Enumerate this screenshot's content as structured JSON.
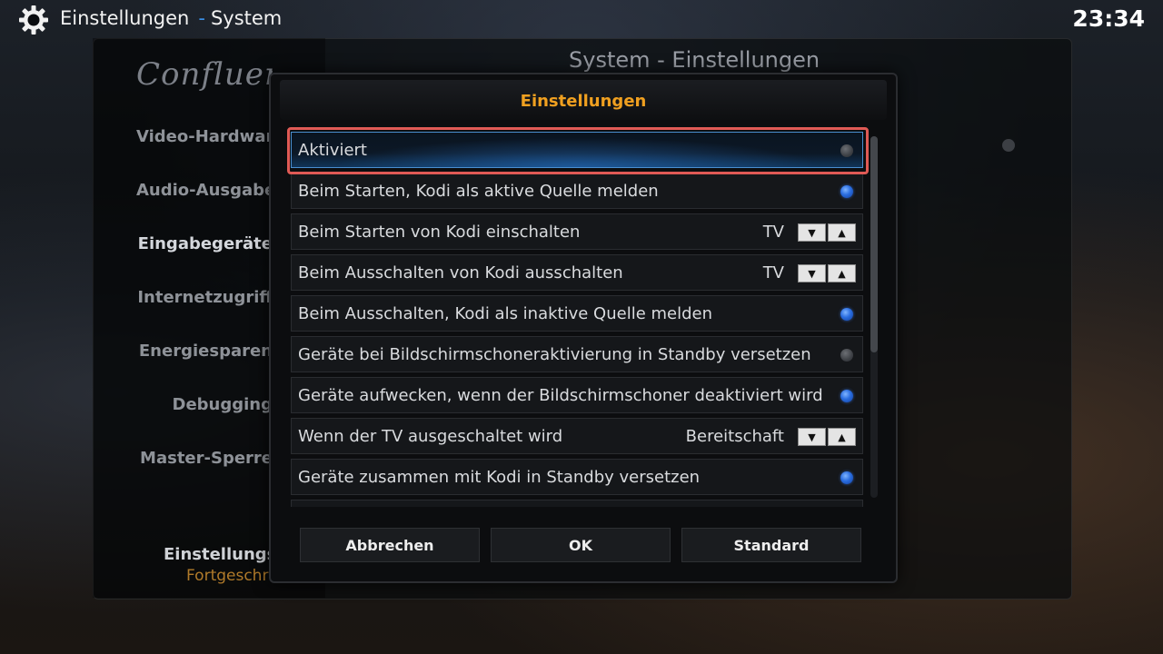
{
  "app": {
    "section": "Einstellungen",
    "subsection": "System",
    "clock": "23:34"
  },
  "background": {
    "logo": "Confluence",
    "panel_title": "System - Einstellungen",
    "categories": [
      {
        "label": "Video-Hardware"
      },
      {
        "label": "Audio-Ausgabe"
      },
      {
        "label": "Eingabegeräte"
      },
      {
        "label": "Internetzugriff"
      },
      {
        "label": "Energiesparen"
      },
      {
        "label": "Debugging"
      },
      {
        "label": "Master-Sperre"
      }
    ],
    "settings_level_label": "Einstellungsebene",
    "settings_level_value": "Fortgeschritten"
  },
  "dialog": {
    "title": "Einstellungen",
    "rows": [
      {
        "label": "Aktiviert",
        "type": "toggle",
        "on": false,
        "focused": true
      },
      {
        "label": "Beim Starten, Kodi als aktive Quelle melden",
        "type": "toggle",
        "on": true
      },
      {
        "label": "Beim Starten von Kodi einschalten",
        "type": "spinner",
        "value": "TV"
      },
      {
        "label": "Beim Ausschalten von Kodi ausschalten",
        "type": "spinner",
        "value": "TV"
      },
      {
        "label": "Beim Ausschalten, Kodi als inaktive Quelle melden",
        "type": "toggle",
        "on": true
      },
      {
        "label": "Geräte bei Bildschirmschoneraktivierung in Standby versetzen",
        "type": "toggle",
        "on": false
      },
      {
        "label": "Geräte aufwecken, wenn der Bildschirmschoner deaktiviert wird",
        "type": "toggle",
        "on": true
      },
      {
        "label": "Wenn der TV ausgeschaltet wird",
        "type": "spinner",
        "value": "Bereitschaft"
      },
      {
        "label": "Geräte zusammen mit Kodi in Standby versetzen",
        "type": "toggle",
        "on": true
      }
    ],
    "buttons": {
      "cancel": "Abbrechen",
      "ok": "OK",
      "default": "Standard"
    }
  },
  "colors": {
    "accent_blue": "#3a8fe6",
    "title_orange": "#f0a020",
    "focus_outline": "#e05a55"
  }
}
